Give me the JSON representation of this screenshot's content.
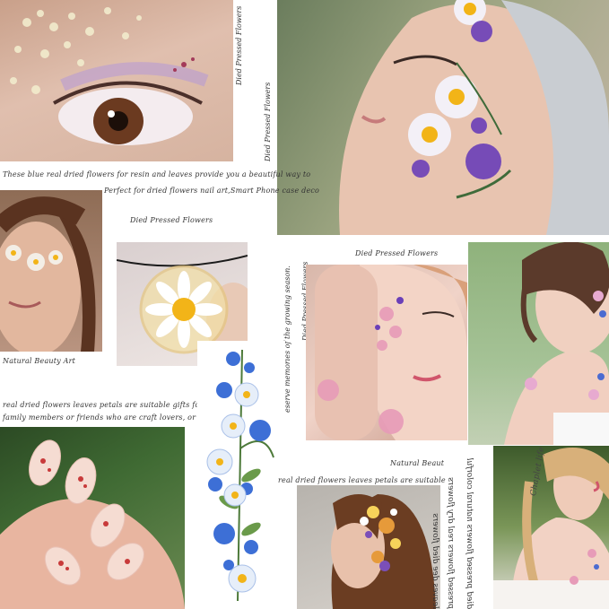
{
  "captions": {
    "top_vertical_1": "Died Pressed Flowers",
    "top_vertical_2": "Died Pressed Flowers",
    "intro_line_1": "These blue real dried flowers for resin and leaves provide you a beautiful way to",
    "intro_line_2": "Perfect for dried flowers nail art,Smart Phone case deco",
    "pendant_caption": "Died Pressed Flowers",
    "middle_caption": "Died Pressed Flowers",
    "middle_vertical": "Died Pressed Flowers",
    "preserve_vertical": "eserve memories of the growing season.",
    "natural_beauty_art": "Natural Beauty Art",
    "gift_line_1": "real dried flowers leaves petals are suitable gifts for your",
    "gift_line_2": "family members or friends who are craft lovers, or you can us",
    "natural_beaut": "Natural Beaut",
    "suitable_line": "real dried flowers leaves petals are suitable",
    "right_vertical_1": "died pressed flowers natural colorful",
    "right_vertical_2": "pressed flowers real dry flowers",
    "right_vertical_3": "leaves dee died flowers",
    "script_text": "Chaplet life"
  },
  "colors": {
    "background": "#ffffff",
    "skin": "#e9c3ad",
    "blue_flower": "#3d6fd6",
    "purple_flower": "#6a3fb8",
    "daisy_center": "#f2b418",
    "green_bg": "#5f8a55"
  }
}
